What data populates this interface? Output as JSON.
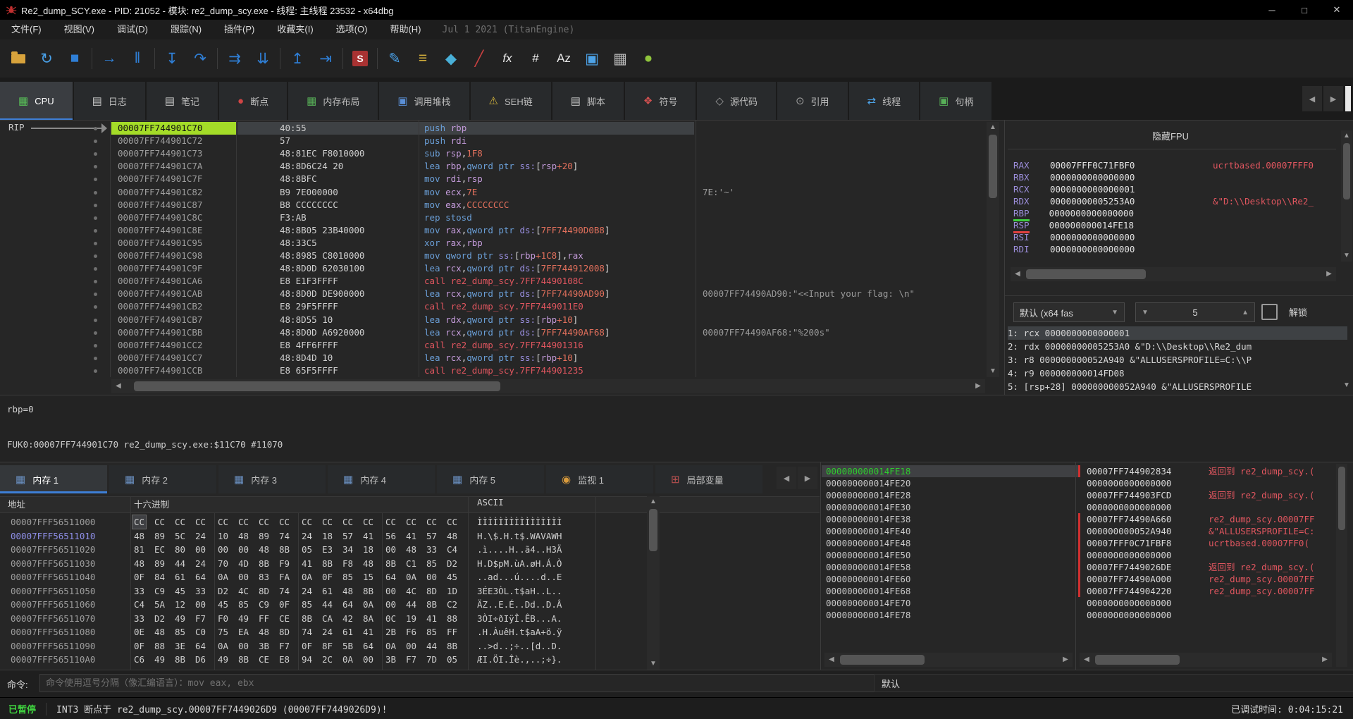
{
  "window": {
    "title": "Re2_dump_SCY.exe - PID: 21052 - 模块: re2_dump_scy.exe - 线程: 主线程 23532 - x64dbg",
    "minimize": "─",
    "maximize": "□",
    "close": "✕"
  },
  "menu": {
    "items": [
      "文件(F)",
      "视图(V)",
      "调试(D)",
      "跟踪(N)",
      "插件(P)",
      "收藏夹(I)",
      "选项(O)",
      "帮助(H)"
    ],
    "build_info": "Jul 1 2021 (TitanEngine)"
  },
  "toolbar": {
    "items": [
      {
        "n": "open-file-icon",
        "folder": true
      },
      {
        "n": "restart-icon",
        "g": "↻",
        "c": "#49a0e8"
      },
      {
        "n": "stop-icon",
        "g": "■",
        "c": "#2f7fd6"
      },
      {
        "sep": true
      },
      {
        "n": "run-icon",
        "g": "→",
        "c": "#2f7fd6"
      },
      {
        "n": "pause-icon",
        "g": "‖",
        "c": "#2f7fd6"
      },
      {
        "sep": true
      },
      {
        "n": "step-into-icon",
        "g": "↧",
        "c": "#2f7fd6"
      },
      {
        "n": "step-over-icon",
        "g": "↷",
        "c": "#2f7fd6"
      },
      {
        "sep": true
      },
      {
        "n": "trace-over-icon",
        "g": "⇉",
        "c": "#2f7fd6"
      },
      {
        "n": "trace-into-icon",
        "g": "⇊",
        "c": "#2f7fd6"
      },
      {
        "sep": true
      },
      {
        "n": "step-out-icon",
        "g": "↥",
        "c": "#2f7fd6"
      },
      {
        "n": "run-to-selection-icon",
        "g": "⇥",
        "c": "#2f7fd6"
      },
      {
        "sep": true
      },
      {
        "n": "scylla-icon",
        "scylla": true,
        "g": "S"
      },
      {
        "sep": true
      },
      {
        "n": "patch-icon",
        "g": "✎",
        "c": "#49a0e8"
      },
      {
        "n": "preferences-icon",
        "g": "≡",
        "c": "#d8b33c"
      },
      {
        "n": "appearance-icon",
        "g": "◆",
        "c": "#49b0d8"
      },
      {
        "n": "hide-debugger-icon",
        "g": "╱",
        "c": "#c84040"
      },
      {
        "n": "functions-icon",
        "g": "fx",
        "c": "#e8e8e8",
        "small": true
      },
      {
        "n": "hash-icon",
        "g": "#",
        "c": "#e8e8e8",
        "small": true
      },
      {
        "n": "strings-icon",
        "g": "Az",
        "c": "#e8e8e8",
        "small": true
      },
      {
        "n": "graph-icon",
        "g": "▣",
        "c": "#4da3e8"
      },
      {
        "n": "calculator-icon",
        "g": "▦",
        "c": "#b8b8b8"
      },
      {
        "n": "help-icon",
        "g": "●",
        "c": "#8fc43c"
      }
    ]
  },
  "tabs": [
    {
      "label": "CPU",
      "icon": "▦",
      "ic": "#58c058",
      "active": true
    },
    {
      "label": "日志",
      "icon": "▤",
      "ic": "#c8c8c8"
    },
    {
      "label": "笔记",
      "icon": "▤",
      "ic": "#c8c8c8"
    },
    {
      "label": "断点",
      "icon": "●",
      "ic": "#d04545"
    },
    {
      "label": "内存布局",
      "icon": "▦",
      "ic": "#58b058"
    },
    {
      "label": "调用堆栈",
      "icon": "▣",
      "ic": "#5a8fd6"
    },
    {
      "label": "SEH链",
      "icon": "⚠",
      "ic": "#d8b83c"
    },
    {
      "label": "脚本",
      "icon": "▤",
      "ic": "#c8c8c8"
    },
    {
      "label": "符号",
      "icon": "❖",
      "ic": "#d05050"
    },
    {
      "label": "源代码",
      "icon": "◇",
      "ic": "#9a9a9a"
    },
    {
      "label": "引用",
      "icon": "⊙",
      "ic": "#9a9a9a"
    },
    {
      "label": "线程",
      "icon": "⇄",
      "ic": "#4da3e8"
    },
    {
      "label": "句柄",
      "icon": "▣",
      "ic": "#58b058"
    }
  ],
  "disasm": {
    "rip_label": "RIP",
    "rows": [
      {
        "a": "00007FF744901C70",
        "b": "40:55",
        "i": [
          "mn|push",
          "t| ",
          "reg|rbp"
        ],
        "cur": true
      },
      {
        "a": "00007FF744901C72",
        "b": "57",
        "i": [
          "mn|push",
          "t| ",
          "reg|rdi"
        ]
      },
      {
        "a": "00007FF744901C73",
        "b": "48:81EC F8010000",
        "i": [
          "mn|sub",
          "t| ",
          "reg|rsp",
          "t|,",
          "num|1F8"
        ]
      },
      {
        "a": "00007FF744901C7A",
        "b": "48:8D6C24 20",
        "i": [
          "mn|lea",
          "t| ",
          "reg|rbp",
          "t|,",
          "kw|qword ptr ",
          "seg|ss:",
          "t|[",
          "reg|rsp",
          "num|+20",
          "t|]"
        ]
      },
      {
        "a": "00007FF744901C7F",
        "b": "48:8BFC",
        "i": [
          "mn|mov",
          "t| ",
          "reg|rdi",
          "t|,",
          "reg|rsp"
        ]
      },
      {
        "a": "00007FF744901C82",
        "b": "B9 7E000000",
        "i": [
          "mn|mov",
          "t| ",
          "reg|ecx",
          "t|,",
          "num|7E"
        ],
        "c": "7E:'~'"
      },
      {
        "a": "00007FF744901C87",
        "b": "B8 CCCCCCCC",
        "i": [
          "mn|mov",
          "t| ",
          "reg|eax",
          "t|,",
          "num|CCCCCCCC"
        ]
      },
      {
        "a": "00007FF744901C8C",
        "b": "F3:AB",
        "i": [
          "mn|rep stosd"
        ]
      },
      {
        "a": "00007FF744901C8E",
        "b": "48:8B05 23B40000",
        "i": [
          "mn|mov",
          "t| ",
          "reg|rax",
          "t|,",
          "kw|qword ptr ",
          "seg|ds:",
          "t|[",
          "num|7FF74490D0B8",
          "t|]"
        ]
      },
      {
        "a": "00007FF744901C95",
        "b": "48:33C5",
        "i": [
          "mn|xor",
          "t| ",
          "reg|rax",
          "t|,",
          "reg|rbp"
        ]
      },
      {
        "a": "00007FF744901C98",
        "b": "48:8985 C8010000",
        "i": [
          "mn|mov",
          "t| ",
          "kw|qword ptr ",
          "seg|ss:",
          "t|[",
          "reg|rbp",
          "num|+1C8",
          "t|],",
          "reg|rax"
        ]
      },
      {
        "a": "00007FF744901C9F",
        "b": "48:8D0D 62030100",
        "i": [
          "mn|lea",
          "t| ",
          "reg|rcx",
          "t|,",
          "kw|qword ptr ",
          "seg|ds:",
          "t|[",
          "num|7FF744912008",
          "t|]"
        ]
      },
      {
        "a": "00007FF744901CA6",
        "b": "E8 E1F3FFFF",
        "i": [
          "call|call re2_dump_scy.7FF74490108C"
        ]
      },
      {
        "a": "00007FF744901CAB",
        "b": "48:8D0D DE900000",
        "i": [
          "mn|lea",
          "t| ",
          "reg|rcx",
          "t|,",
          "kw|qword ptr ",
          "seg|ds:",
          "t|[",
          "num|7FF74490AD90",
          "t|]"
        ],
        "c": "00007FF74490AD90:\"<<Input your flag: \\n\""
      },
      {
        "a": "00007FF744901CB2",
        "b": "E8 29F5FFFF",
        "i": [
          "call|call re2_dump_scy.7FF7449011E0"
        ]
      },
      {
        "a": "00007FF744901CB7",
        "b": "48:8D55 10",
        "i": [
          "mn|lea",
          "t| ",
          "reg|rdx",
          "t|,",
          "kw|qword ptr ",
          "seg|ss:",
          "t|[",
          "reg|rbp",
          "num|+10",
          "t|]"
        ]
      },
      {
        "a": "00007FF744901CBB",
        "b": "48:8D0D A6920000",
        "i": [
          "mn|lea",
          "t| ",
          "reg|rcx",
          "t|,",
          "kw|qword ptr ",
          "seg|ds:",
          "t|[",
          "num|7FF74490AF68",
          "t|]"
        ],
        "c": "00007FF74490AF68:\"%200s\""
      },
      {
        "a": "00007FF744901CC2",
        "b": "E8 4FF6FFFF",
        "i": [
          "call|call re2_dump_scy.7FF744901316"
        ]
      },
      {
        "a": "00007FF744901CC7",
        "b": "48:8D4D 10",
        "i": [
          "mn|lea",
          "t| ",
          "reg|rcx",
          "t|,",
          "kw|qword ptr ",
          "seg|ss:",
          "t|[",
          "reg|rbp",
          "num|+10",
          "t|]"
        ]
      },
      {
        "a": "00007FF744901CCB",
        "b": "E8 65F5FFFF",
        "i": [
          "call|call re2_dump_scy.7FF744901235"
        ]
      }
    ]
  },
  "registers": {
    "header": "隐藏FPU",
    "rows": [
      {
        "n": "RAX",
        "v": "00007FFF0C71FBF0",
        "c": "ucrtbased.00007FFF0"
      },
      {
        "n": "RBX",
        "v": "0000000000000000"
      },
      {
        "n": "RCX",
        "v": "0000000000000001"
      },
      {
        "n": "RDX",
        "v": "00000000005253A0",
        "c": "&\"D:\\\\Desktop\\\\Re2_"
      },
      {
        "n": "RBP",
        "v": "0000000000000000",
        "u": "green"
      },
      {
        "n": "RSP",
        "v": "000000000014FE18",
        "u": "red"
      },
      {
        "n": "RSI",
        "v": "0000000000000000"
      },
      {
        "n": "RDI",
        "v": "0000000000000000"
      }
    ],
    "convention": {
      "default_label": "默认 (x64 fas",
      "depth_value": "5",
      "unlock_label": "解锁"
    },
    "args": [
      {
        "t": "1: rcx 0000000000000001",
        "sel": true
      },
      {
        "t": "2: rdx 00000000005253A0 &\"D:\\\\Desktop\\\\Re2_dum"
      },
      {
        "t": "3: r8 000000000052A940 &\"ALLUSERSPROFILE=C:\\\\P"
      },
      {
        "t": "4: r9 000000000014FD08"
      },
      {
        "t": "5: [rsp+28] 000000000052A940 &\"ALLUSERSPROFILE"
      }
    ]
  },
  "info": {
    "rbp_line": "rbp=0",
    "status_line": "FUK0:00007FF744901C70 re2_dump_scy.exe:$11C70 #11070"
  },
  "bottom_tabs": [
    {
      "label": "内存 1",
      "icon": "▦",
      "ic": "#6a8fc0",
      "active": true
    },
    {
      "label": "内存 2",
      "icon": "▦",
      "ic": "#6a8fc0"
    },
    {
      "label": "内存 3",
      "icon": "▦",
      "ic": "#6a8fc0"
    },
    {
      "label": "内存 4",
      "icon": "▦",
      "ic": "#6a8fc0"
    },
    {
      "label": "内存 5",
      "icon": "▦",
      "ic": "#6a8fc0"
    },
    {
      "label": "监视 1",
      "icon": "◉",
      "ic": "#d89a3c"
    },
    {
      "label": "局部变量",
      "icon": "⊞",
      "ic": "#b85050"
    }
  ],
  "dump": {
    "headers": {
      "address": "地址",
      "hex": "十六进制",
      "ascii": "ASCII"
    },
    "rows": [
      {
        "a": "00007FFF56511000",
        "bytes": "CC CC CC CC CC CC CC CC CC CC CC CC CC CC CC CC",
        "ascii": "ÌÌÌÌÌÌÌÌÌÌÌÌÌÌÌÌ",
        "sel_byte": 0
      },
      {
        "a": "00007FFF56511010",
        "bytes": "48 89 5C 24 10 48 89 74 24 18 57 41 56 41 57 48",
        "ascii": "H.\\$.H.t$.WAVAWH",
        "sel": true
      },
      {
        "a": "00007FFF56511020",
        "bytes": "81 EC 80 00 00 00 48 8B 05 E3 34 18 00 48 33 C4",
        "ascii": ".ì....H..ã4..H3Ä"
      },
      {
        "a": "00007FFF56511030",
        "bytes": "48 89 44 24 70 4D 8B F9 41 8B F8 48 8B C1 85 D2",
        "ascii": "H.D$pM.ùA.øH.Á.Ò"
      },
      {
        "a": "00007FFF56511040",
        "bytes": "0F 84 61 64 0A 00 83 FA 0A 0F 85 15 64 0A 00 45",
        "ascii": "..ad...ú....d..E"
      },
      {
        "a": "00007FFF56511050",
        "bytes": "33 C9 45 33 D2 4C 8D 74 24 61 48 8B 00 4C 8D 1D",
        "ascii": "3ÉE3ÒL.t$aH..L.."
      },
      {
        "a": "00007FFF56511060",
        "bytes": "C4 5A 12 00 45 85 C9 0F 85 44 64 0A 00 44 8B C2",
        "ascii": "ÄZ..E.É..Dd..D.Â"
      },
      {
        "a": "00007FFF56511070",
        "bytes": "33 D2 49 F7 F0 49 FF CE 8B CA 42 8A 0C 19 41 88",
        "ascii": "3ÒI÷ðIÿÎ.ÊB...A."
      },
      {
        "a": "00007FFF56511080",
        "bytes": "0E 48 85 C0 75 EA 48 8D 74 24 61 41 2B F6 85 FF",
        "ascii": ".H.ÀuêH.t$aA+ö.ÿ"
      },
      {
        "a": "00007FFF56511090",
        "bytes": "0F 88 3E 64 0A 00 3B F7 0F 8F 5B 64 0A 00 44 8B",
        "ascii": "..>d..;÷..[d..D."
      },
      {
        "a": "00007FFF565110A0",
        "bytes": "C6 49 8B D6 49 8B CE E8 94 2C 0A 00 3B F7 7D 05",
        "ascii": "ÆI.ÖI.Îè.,..;÷}.",
        "cut": true
      }
    ]
  },
  "stack": {
    "addresses": [
      "000000000014FE18",
      "000000000014FE20",
      "000000000014FE28",
      "000000000014FE30",
      "000000000014FE38",
      "000000000014FE40",
      "000000000014FE48",
      "000000000014FE50",
      "000000000014FE58",
      "000000000014FE60",
      "000000000014FE68",
      "000000000014FE70",
      "000000000014FE78"
    ],
    "values": [
      {
        "v": "00007FF744902834",
        "c": "返回到 re2_dump_scy.(",
        "br": true
      },
      {
        "v": "0000000000000000"
      },
      {
        "v": "00007FF744903FCD",
        "c": "返回到 re2_dump_scy.("
      },
      {
        "v": "0000000000000000"
      },
      {
        "v": "00007FF74490A660",
        "c": "re2_dump_scy.00007FF",
        "br": true
      },
      {
        "v": "000000000052A940",
        "c": "&\"ALLUSERSPROFILE=C:",
        "br": true
      },
      {
        "v": "00007FFF0C71FBF8",
        "c": "ucrtbased.00007FF0(",
        "br": true
      },
      {
        "v": "0000000000000000",
        "br": true
      },
      {
        "v": "00007FF7449026DE",
        "c": "返回到 re2_dump_scy.(",
        "br": true
      },
      {
        "v": "00007FF74490A000",
        "c": "re2_dump_scy.00007FF",
        "br": true
      },
      {
        "v": "00007FF744904220",
        "c": "re2_dump_scy.00007FF",
        "br": true
      },
      {
        "v": "0000000000000000"
      },
      {
        "v": "0000000000000000"
      }
    ]
  },
  "command": {
    "label": "命令:",
    "placeholder": "命令使用逗号分隔（像汇编语言）：mov eax, ebx",
    "mode": "默认"
  },
  "status": {
    "state": "已暂停",
    "message": "INT3 断点于 re2_dump_scy.00007FF7449026D9 (00007FF7449026D9)!",
    "time": "已调试时间: 0:04:15:21"
  }
}
